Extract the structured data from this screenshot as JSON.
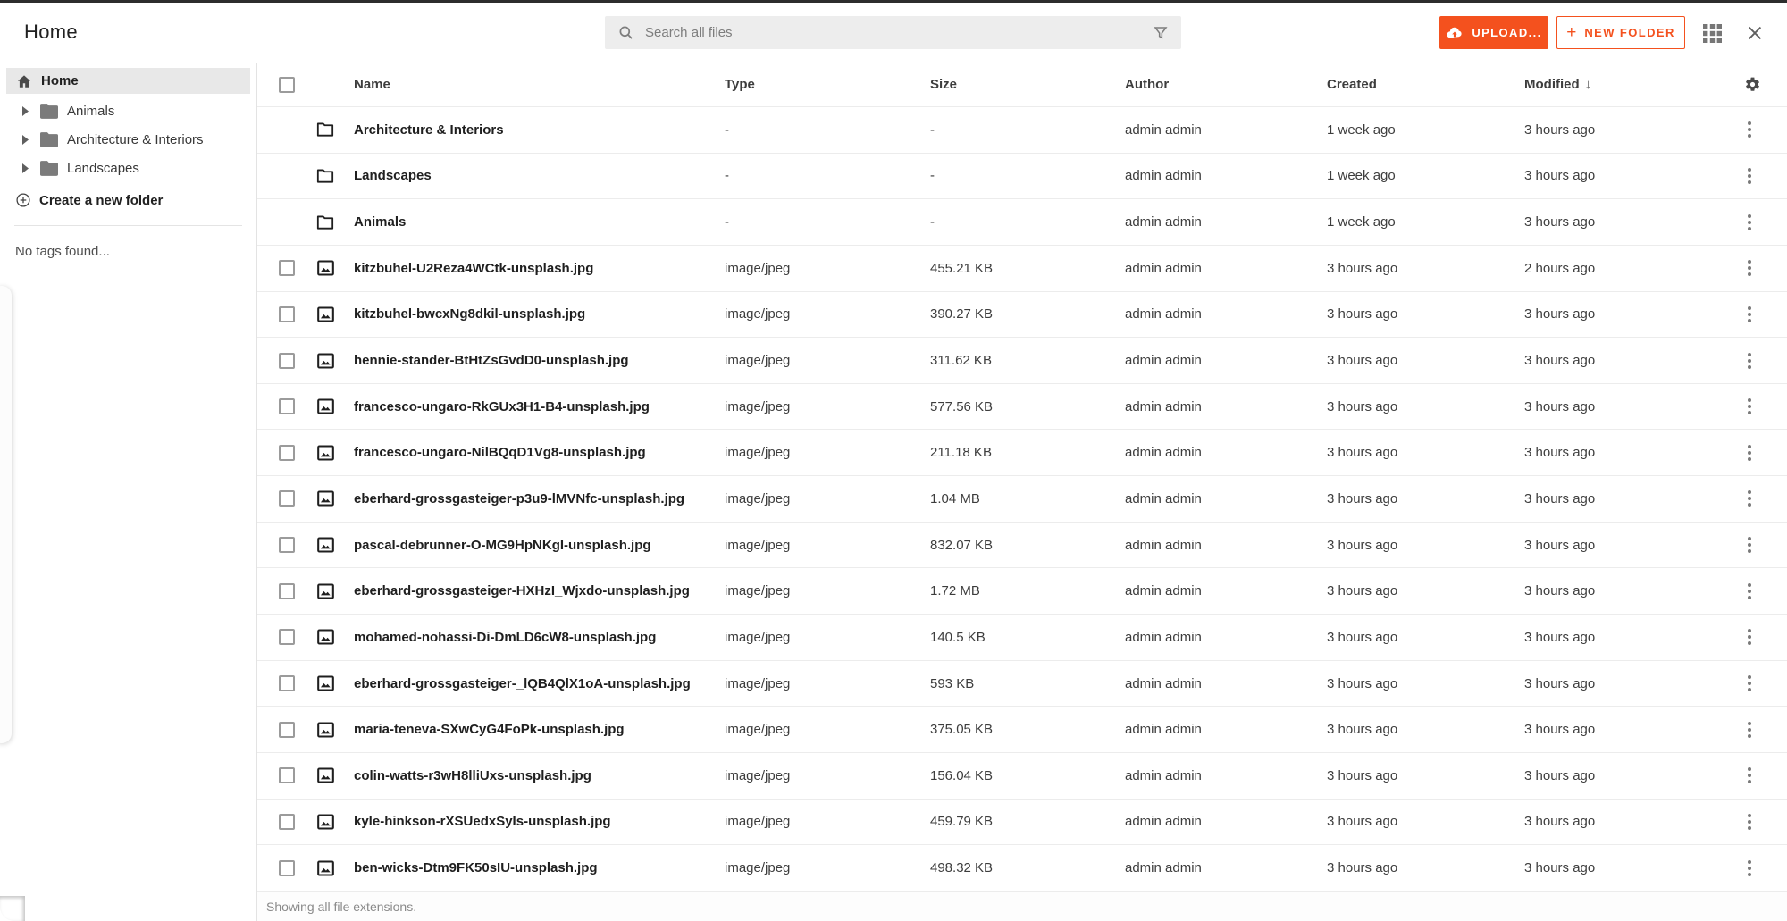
{
  "colors": {
    "accent": "#f4511e",
    "selected_bg": "#e8e8e8"
  },
  "header": {
    "title": "Home",
    "search": {
      "placeholder": "Search all files"
    },
    "upload_label": "UPLOAD...",
    "new_folder_label": "NEW FOLDER",
    "new_folder_plus": "+"
  },
  "icons": [
    "search-icon",
    "filter-icon",
    "cloud-upload-icon",
    "grid-view-icon",
    "close-icon",
    "home-icon",
    "caret-right-icon",
    "folder-icon",
    "plus-circle-icon",
    "image-file-icon",
    "gear-icon",
    "kebab-menu-icon",
    "sort-desc-arrow"
  ],
  "sidebar": {
    "root": {
      "label": "Home"
    },
    "folders": [
      {
        "label": "Animals"
      },
      {
        "label": "Architecture & Interiors"
      },
      {
        "label": "Landscapes"
      }
    ],
    "create_folder_label": "Create a new folder",
    "no_tags_text": "No tags found..."
  },
  "table": {
    "columns": [
      "Name",
      "Type",
      "Size",
      "Author",
      "Created",
      "Modified"
    ],
    "sort": {
      "column": "Modified",
      "direction": "desc",
      "arrow": "↓"
    },
    "rows": [
      {
        "kind": "folder",
        "name": "Architecture & Interiors",
        "type": "-",
        "size": "-",
        "author": "admin admin",
        "created": "1 week ago",
        "modified": "3 hours ago"
      },
      {
        "kind": "folder",
        "name": "Landscapes",
        "type": "-",
        "size": "-",
        "author": "admin admin",
        "created": "1 week ago",
        "modified": "3 hours ago"
      },
      {
        "kind": "folder",
        "name": "Animals",
        "type": "-",
        "size": "-",
        "author": "admin admin",
        "created": "1 week ago",
        "modified": "3 hours ago"
      },
      {
        "kind": "file",
        "name": "kitzbuhel-U2Reza4WCtk-unsplash.jpg",
        "type": "image/jpeg",
        "size": "455.21 KB",
        "author": "admin admin",
        "created": "3 hours ago",
        "modified": "2 hours ago"
      },
      {
        "kind": "file",
        "name": "kitzbuhel-bwcxNg8dkil-unsplash.jpg",
        "type": "image/jpeg",
        "size": "390.27 KB",
        "author": "admin admin",
        "created": "3 hours ago",
        "modified": "3 hours ago"
      },
      {
        "kind": "file",
        "name": "hennie-stander-BtHtZsGvdD0-unsplash.jpg",
        "type": "image/jpeg",
        "size": "311.62 KB",
        "author": "admin admin",
        "created": "3 hours ago",
        "modified": "3 hours ago"
      },
      {
        "kind": "file",
        "name": "francesco-ungaro-RkGUx3H1-B4-unsplash.jpg",
        "type": "image/jpeg",
        "size": "577.56 KB",
        "author": "admin admin",
        "created": "3 hours ago",
        "modified": "3 hours ago"
      },
      {
        "kind": "file",
        "name": "francesco-ungaro-NilBQqD1Vg8-unsplash.jpg",
        "type": "image/jpeg",
        "size": "211.18 KB",
        "author": "admin admin",
        "created": "3 hours ago",
        "modified": "3 hours ago"
      },
      {
        "kind": "file",
        "name": "eberhard-grossgasteiger-p3u9-lMVNfc-unsplash.jpg",
        "type": "image/jpeg",
        "size": "1.04 MB",
        "author": "admin admin",
        "created": "3 hours ago",
        "modified": "3 hours ago"
      },
      {
        "kind": "file",
        "name": "pascal-debrunner-O-MG9HpNKgI-unsplash.jpg",
        "type": "image/jpeg",
        "size": "832.07 KB",
        "author": "admin admin",
        "created": "3 hours ago",
        "modified": "3 hours ago"
      },
      {
        "kind": "file",
        "name": "eberhard-grossgasteiger-HXHzI_Wjxdo-unsplash.jpg",
        "type": "image/jpeg",
        "size": "1.72 MB",
        "author": "admin admin",
        "created": "3 hours ago",
        "modified": "3 hours ago"
      },
      {
        "kind": "file",
        "name": "mohamed-nohassi-Di-DmLD6cW8-unsplash.jpg",
        "type": "image/jpeg",
        "size": "140.5 KB",
        "author": "admin admin",
        "created": "3 hours ago",
        "modified": "3 hours ago"
      },
      {
        "kind": "file",
        "name": "eberhard-grossgasteiger-_lQB4QlX1oA-unsplash.jpg",
        "type": "image/jpeg",
        "size": "593 KB",
        "author": "admin admin",
        "created": "3 hours ago",
        "modified": "3 hours ago"
      },
      {
        "kind": "file",
        "name": "maria-teneva-SXwCyG4FoPk-unsplash.jpg",
        "type": "image/jpeg",
        "size": "375.05 KB",
        "author": "admin admin",
        "created": "3 hours ago",
        "modified": "3 hours ago"
      },
      {
        "kind": "file",
        "name": "colin-watts-r3wH8lliUxs-unsplash.jpg",
        "type": "image/jpeg",
        "size": "156.04 KB",
        "author": "admin admin",
        "created": "3 hours ago",
        "modified": "3 hours ago"
      },
      {
        "kind": "file",
        "name": "kyle-hinkson-rXSUedxSyIs-unsplash.jpg",
        "type": "image/jpeg",
        "size": "459.79 KB",
        "author": "admin admin",
        "created": "3 hours ago",
        "modified": "3 hours ago"
      },
      {
        "kind": "file",
        "name": "ben-wicks-Dtm9FK50sIU-unsplash.jpg",
        "type": "image/jpeg",
        "size": "498.32 KB",
        "author": "admin admin",
        "created": "3 hours ago",
        "modified": "3 hours ago"
      }
    ]
  },
  "footer": {
    "text": "Showing all file extensions."
  }
}
